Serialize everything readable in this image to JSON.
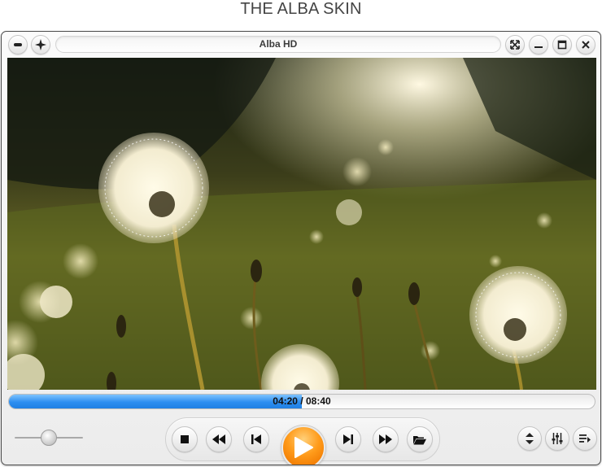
{
  "page_heading": "THE ALBA SKIN",
  "window": {
    "title": "Alba HD"
  },
  "playback": {
    "current_time": "04:20",
    "separator": " / ",
    "duration": "08:40",
    "progress_fraction": 0.5,
    "volume_fraction": 0.5
  },
  "icons": {
    "titlebar_left": [
      "minus-icon",
      "sparkle-icon"
    ],
    "titlebar_right": [
      "fullscreen-icon",
      "minimize-icon",
      "maximize-icon",
      "close-icon"
    ],
    "transport": [
      "stop-icon",
      "rewind-icon",
      "previous-icon",
      "play-icon",
      "next-icon",
      "fast-forward-icon",
      "open-folder-icon"
    ],
    "right_controls": [
      "up-down-icon",
      "equalizer-icon",
      "playlist-icon"
    ]
  },
  "colors": {
    "progress_blue": "#2d8ef0",
    "play_orange": "#ff9b1a"
  }
}
